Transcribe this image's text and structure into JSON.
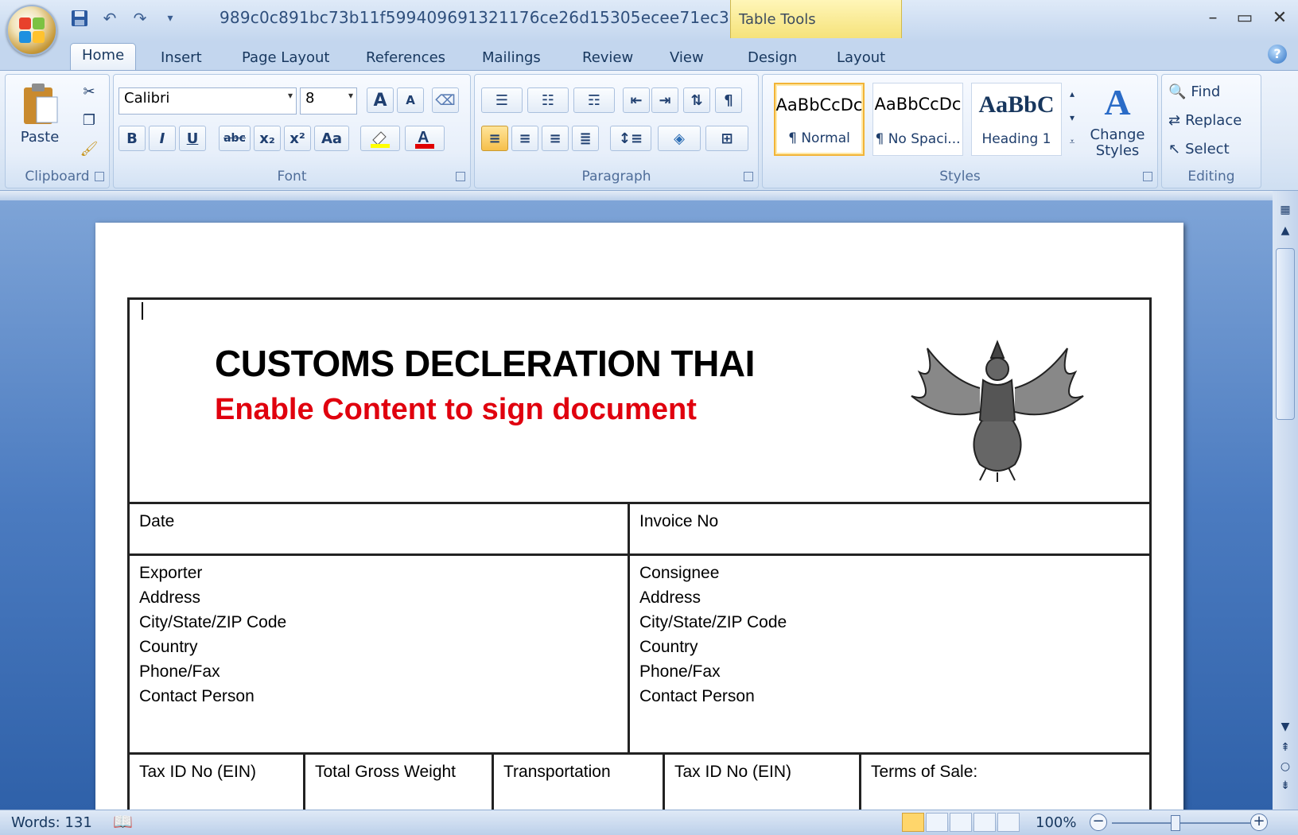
{
  "window": {
    "doc_title": "989c0c891bc73b11f599409691321176ce26d15305ecee71ec3...",
    "contextual_tab_group": "Table Tools",
    "minimize": "–",
    "maximize": "▭",
    "close": "✕"
  },
  "quick_access": {
    "save_icon": "save-icon",
    "undo_icon": "undo-icon",
    "redo_icon": "redo-icon",
    "customize": "▾"
  },
  "tabs": [
    "Home",
    "Insert",
    "Page Layout",
    "References",
    "Mailings",
    "Review",
    "View",
    "Design",
    "Layout"
  ],
  "ribbon": {
    "clipboard": {
      "paste_label": "Paste",
      "group_label": "Clipboard"
    },
    "font": {
      "font_name": "Calibri",
      "font_size": "8",
      "group_label": "Font",
      "bold": "B",
      "italic": "I",
      "underline": "U",
      "strike": "abc",
      "subscript": "x₂",
      "superscript": "x²",
      "change_case": "Aa",
      "grow": "A",
      "shrink": "A"
    },
    "paragraph": {
      "group_label": "Paragraph"
    },
    "styles": {
      "group_label": "Styles",
      "cards": [
        {
          "sample": "AaBbCcDc",
          "name": "¶ Normal"
        },
        {
          "sample": "AaBbCcDc",
          "name": "¶ No Spaci..."
        },
        {
          "sample": "AaBbC",
          "name": "Heading 1"
        }
      ],
      "change_styles": "Change Styles"
    },
    "editing": {
      "find": "Find",
      "replace": "Replace",
      "select": "Select",
      "group_label": "Editing"
    }
  },
  "document": {
    "title": "CUSTOMS DECLERATION THAI",
    "subtitle": "Enable Content to sign document",
    "date_label": "Date",
    "invoice_label": "Invoice No",
    "exporter_lines": [
      "Exporter",
      "Address",
      "City/State/ZIP Code",
      "Country",
      "Phone/Fax",
      "Contact Person"
    ],
    "consignee_lines": [
      "Consignee",
      "Address",
      "City/State/ZIP Code",
      "Country",
      "Phone/Fax",
      "Contact Person"
    ],
    "bottom_row": [
      "Tax ID No (EIN)",
      "Total Gross Weight",
      "Transportation",
      "Tax ID No (EIN)",
      "Terms of Sale:"
    ]
  },
  "status_bar": {
    "words": "Words: 131",
    "zoom": "100%"
  },
  "colors": {
    "accent_red": "#e0000e",
    "ribbon_blue": "#1e3d6b",
    "doc_bg": "#4b7bc0"
  }
}
